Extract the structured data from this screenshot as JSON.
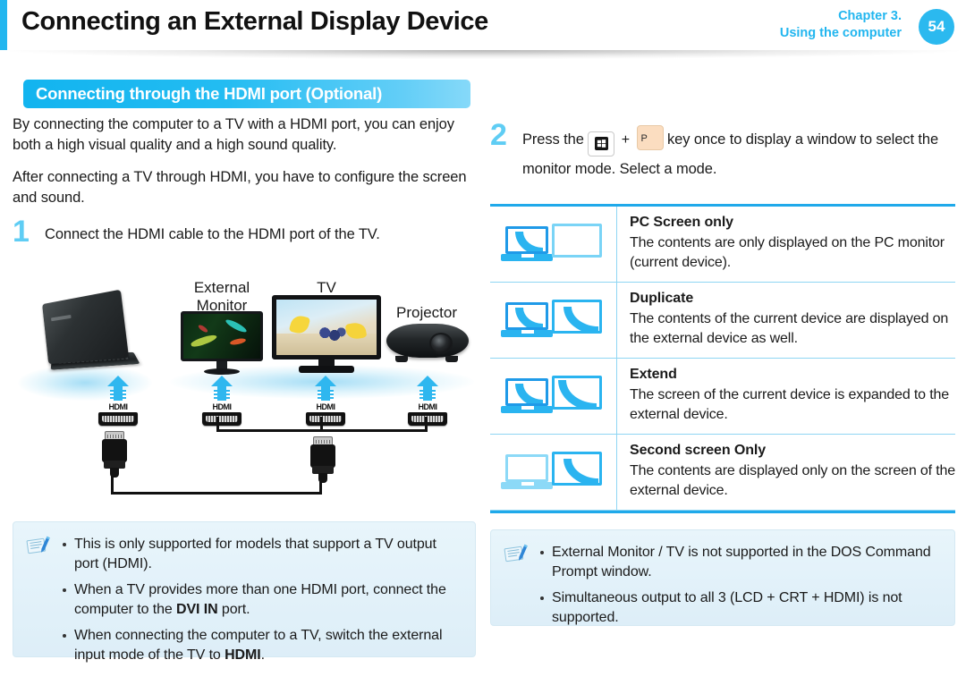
{
  "header": {
    "title": "Connecting an External Display Device",
    "chapter": "Chapter 3.",
    "chapter_sub": "Using the computer",
    "page_number": "54",
    "accent_color": "#22b6ef"
  },
  "section": {
    "heading": "Connecting through the HDMI port (Optional)"
  },
  "left": {
    "intro_1": "By connecting the computer to a TV with a HDMI port, you can enjoy both a high visual quality and a high sound quality.",
    "intro_2": "After connecting a TV through HDMI, you have to configure the screen and sound.",
    "step1_num": "1",
    "step1_text": "Connect the HDMI cable to the HDMI port of the TV.",
    "diagram": {
      "labels": {
        "monitor_line1": "External",
        "monitor_line2": "Monitor",
        "tv": "TV",
        "projector": "Projector"
      },
      "port_label": "HDMI",
      "port_count": 4
    },
    "note": {
      "icon": "note-pen-icon",
      "items": [
        "This is only supported for models that support a TV output port (HDMI).",
        "When a TV provides more than one HDMI port, connect the computer to the DVI IN port.",
        "When connecting the computer to a TV, switch the external input mode of the TV to HDMI."
      ],
      "bold_terms": [
        "DVI IN",
        "HDMI"
      ]
    }
  },
  "right": {
    "step2_num": "2",
    "step2_text_before": "Press the",
    "key_windows": "windows-key-icon",
    "key_plus": "+",
    "key_p": "P",
    "step2_text_after": "key once to display a window to select the monitor mode. Select a mode.",
    "modes": [
      {
        "icon": "pc-screen-only-icon",
        "title": "PC Screen only",
        "description": "The contents are only displayed on the PC monitor (current device)."
      },
      {
        "icon": "duplicate-icon",
        "title": "Duplicate",
        "description": "The contents of the current device are displayed on the external device as well."
      },
      {
        "icon": "extend-icon",
        "title": "Extend",
        "description": "The screen of the current device is expanded to the external device."
      },
      {
        "icon": "second-screen-only-icon",
        "title": "Second screen Only",
        "description": "The contents are displayed only on the screen of the external device."
      }
    ],
    "note": {
      "icon": "note-pen-icon",
      "items": [
        "External Monitor / TV is not supported in the DOS Command Prompt window.",
        "Simultaneous output to all 3 (LCD + CRT + HDMI) is not supported."
      ]
    }
  }
}
